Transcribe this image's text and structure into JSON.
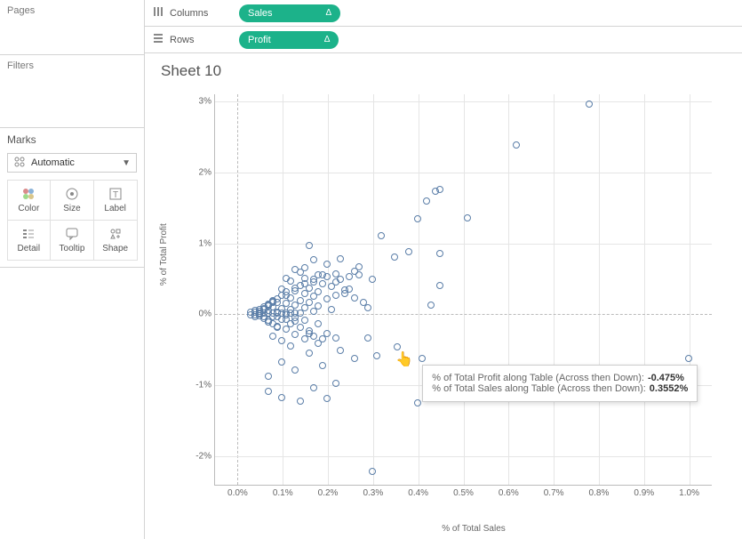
{
  "panels": {
    "pages_label": "Pages",
    "filters_label": "Filters",
    "marks_label": "Marks"
  },
  "marks": {
    "dropdown_label": "Automatic",
    "icon_name": "auto-shape-icon",
    "cells": [
      {
        "name": "color-button",
        "label": "Color",
        "icon": "color-icon"
      },
      {
        "name": "size-button",
        "label": "Size",
        "icon": "size-icon"
      },
      {
        "name": "label-button",
        "label": "Label",
        "icon": "label-icon"
      },
      {
        "name": "detail-button",
        "label": "Detail",
        "icon": "detail-icon"
      },
      {
        "name": "tooltip-button",
        "label": "Tooltip",
        "icon": "tooltip-icon"
      },
      {
        "name": "shape-button",
        "label": "Shape",
        "icon": "shape-icon"
      }
    ]
  },
  "shelves": {
    "columns_label": "Columns",
    "rows_label": "Rows",
    "columns_pill": "Sales",
    "rows_pill": "Profit",
    "tri": "Δ"
  },
  "sheet": {
    "title": "Sheet 10"
  },
  "tooltip": {
    "profit_label": "% of Total Profit along Table (Across then Down):",
    "profit_value": "-0.475%",
    "sales_label": "% of Total Sales along Table (Across then Down):",
    "sales_value": "0.3552%"
  },
  "chart_data": {
    "type": "scatter",
    "title": "Sheet 10",
    "xlabel": "% of Total Sales",
    "ylabel": "% of Total Profit",
    "xlim": [
      -0.05,
      1.05
    ],
    "ylim": [
      -2.4,
      3.1
    ],
    "x_ticks": [
      0.0,
      0.1,
      0.2,
      0.3,
      0.4,
      0.5,
      0.6,
      0.7,
      0.8,
      0.9,
      1.0
    ],
    "x_tick_labels": [
      "0.0%",
      "0.1%",
      "0.2%",
      "0.3%",
      "0.4%",
      "0.5%",
      "0.6%",
      "0.7%",
      "0.8%",
      "0.9%",
      "1.0%"
    ],
    "y_ticks": [
      -2,
      -1,
      0,
      1,
      2,
      3
    ],
    "y_tick_labels": [
      "-2%",
      "-1%",
      "0%",
      "1%",
      "2%",
      "3%"
    ],
    "hovered_point": {
      "x": 0.3552,
      "y": -0.475
    },
    "series": [
      {
        "name": "points",
        "points": [
          [
            0.78,
            2.95
          ],
          [
            0.62,
            2.37
          ],
          [
            0.45,
            1.75
          ],
          [
            0.44,
            1.72
          ],
          [
            0.42,
            1.58
          ],
          [
            0.51,
            1.35
          ],
          [
            0.4,
            1.33
          ],
          [
            0.32,
            1.1
          ],
          [
            0.16,
            0.96
          ],
          [
            0.38,
            0.87
          ],
          [
            0.45,
            0.85
          ],
          [
            0.35,
            0.8
          ],
          [
            0.23,
            0.77
          ],
          [
            0.17,
            0.76
          ],
          [
            0.2,
            0.69
          ],
          [
            0.27,
            0.66
          ],
          [
            0.15,
            0.64
          ],
          [
            0.13,
            0.62
          ],
          [
            0.26,
            0.6
          ],
          [
            0.14,
            0.58
          ],
          [
            0.22,
            0.56
          ],
          [
            0.18,
            0.54
          ],
          [
            0.2,
            0.52
          ],
          [
            0.11,
            0.5
          ],
          [
            0.23,
            0.48
          ],
          [
            0.12,
            0.46
          ],
          [
            0.17,
            0.44
          ],
          [
            0.19,
            0.42
          ],
          [
            0.45,
            0.4
          ],
          [
            0.14,
            0.4
          ],
          [
            0.21,
            0.38
          ],
          [
            0.16,
            0.36
          ],
          [
            0.1,
            0.34
          ],
          [
            0.24,
            0.33
          ],
          [
            0.13,
            0.32
          ],
          [
            0.18,
            0.3
          ],
          [
            0.15,
            0.28
          ],
          [
            0.11,
            0.26
          ],
          [
            0.22,
            0.25
          ],
          [
            0.17,
            0.24
          ],
          [
            0.12,
            0.22
          ],
          [
            0.2,
            0.2
          ],
          [
            0.14,
            0.18
          ],
          [
            0.09,
            0.16
          ],
          [
            0.16,
            0.15
          ],
          [
            0.11,
            0.14
          ],
          [
            0.43,
            0.12
          ],
          [
            0.13,
            0.12
          ],
          [
            0.18,
            0.1
          ],
          [
            0.08,
            0.09
          ],
          [
            0.15,
            0.08
          ],
          [
            0.1,
            0.07
          ],
          [
            0.21,
            0.06
          ],
          [
            0.12,
            0.05
          ],
          [
            0.07,
            0.04
          ],
          [
            0.17,
            0.03
          ],
          [
            0.09,
            0.02
          ],
          [
            0.14,
            0.01
          ],
          [
            0.06,
            0.0
          ],
          [
            0.07,
            0.0
          ],
          [
            0.08,
            0.0
          ],
          [
            0.09,
            0.0
          ],
          [
            0.1,
            0.0
          ],
          [
            0.11,
            0.0
          ],
          [
            0.12,
            0.0
          ],
          [
            0.13,
            0.0
          ],
          [
            0.05,
            0.01
          ],
          [
            0.05,
            -0.01
          ],
          [
            0.04,
            0.02
          ],
          [
            0.04,
            -0.02
          ],
          [
            0.11,
            -0.02
          ],
          [
            0.08,
            -0.04
          ],
          [
            0.13,
            -0.06
          ],
          [
            0.1,
            -0.08
          ],
          [
            0.15,
            -0.1
          ],
          [
            0.07,
            -0.12
          ],
          [
            0.12,
            -0.14
          ],
          [
            0.18,
            -0.15
          ],
          [
            0.09,
            -0.18
          ],
          [
            0.14,
            -0.2
          ],
          [
            0.11,
            -0.22
          ],
          [
            0.16,
            -0.25
          ],
          [
            0.2,
            -0.28
          ],
          [
            0.13,
            -0.3
          ],
          [
            0.08,
            -0.32
          ],
          [
            0.22,
            -0.34
          ],
          [
            0.29,
            -0.34
          ],
          [
            0.15,
            -0.36
          ],
          [
            0.1,
            -0.38
          ],
          [
            0.18,
            -0.42
          ],
          [
            0.12,
            -0.46
          ],
          [
            0.3552,
            -0.475
          ],
          [
            0.23,
            -0.52
          ],
          [
            0.16,
            -0.56
          ],
          [
            0.31,
            -0.6
          ],
          [
            0.26,
            -0.63
          ],
          [
            0.41,
            -0.63
          ],
          [
            1.0,
            -0.63
          ],
          [
            0.1,
            -0.68
          ],
          [
            0.19,
            -0.73
          ],
          [
            0.13,
            -0.8
          ],
          [
            0.07,
            -0.88
          ],
          [
            0.22,
            -0.99
          ],
          [
            0.17,
            -1.05
          ],
          [
            0.07,
            -1.1
          ],
          [
            0.1,
            -1.18
          ],
          [
            0.2,
            -1.2
          ],
          [
            0.14,
            -1.24
          ],
          [
            0.4,
            -1.26
          ],
          [
            0.3,
            -2.23
          ],
          [
            0.06,
            0.05
          ],
          [
            0.07,
            0.1
          ],
          [
            0.08,
            0.15
          ],
          [
            0.09,
            0.2
          ],
          [
            0.1,
            0.25
          ],
          [
            0.06,
            -0.05
          ],
          [
            0.07,
            -0.1
          ],
          [
            0.08,
            -0.15
          ],
          [
            0.09,
            -0.2
          ],
          [
            0.05,
            0.03
          ],
          [
            0.06,
            0.07
          ],
          [
            0.07,
            0.12
          ],
          [
            0.08,
            0.18
          ],
          [
            0.05,
            -0.03
          ],
          [
            0.06,
            -0.07
          ],
          [
            0.07,
            -0.12
          ],
          [
            0.04,
            0.04
          ],
          [
            0.04,
            -0.04
          ],
          [
            0.03,
            0.02
          ],
          [
            0.03,
            -0.02
          ],
          [
            0.15,
            0.5
          ],
          [
            0.19,
            0.55
          ],
          [
            0.22,
            0.45
          ],
          [
            0.25,
            0.35
          ],
          [
            0.24,
            0.28
          ],
          [
            0.26,
            0.22
          ],
          [
            0.28,
            0.15
          ],
          [
            0.29,
            0.08
          ],
          [
            0.16,
            -0.28
          ],
          [
            0.17,
            -0.32
          ],
          [
            0.19,
            -0.36
          ],
          [
            0.11,
            0.3
          ],
          [
            0.13,
            0.36
          ],
          [
            0.15,
            0.42
          ],
          [
            0.17,
            0.48
          ],
          [
            0.09,
            -0.05
          ],
          [
            0.11,
            -0.08
          ],
          [
            0.13,
            -0.11
          ],
          [
            0.05,
            0.06
          ],
          [
            0.06,
            0.09
          ],
          [
            0.07,
            0.13
          ],
          [
            0.08,
            0.17
          ],
          [
            0.25,
            0.52
          ],
          [
            0.27,
            0.55
          ],
          [
            0.3,
            0.48
          ]
        ]
      }
    ]
  }
}
